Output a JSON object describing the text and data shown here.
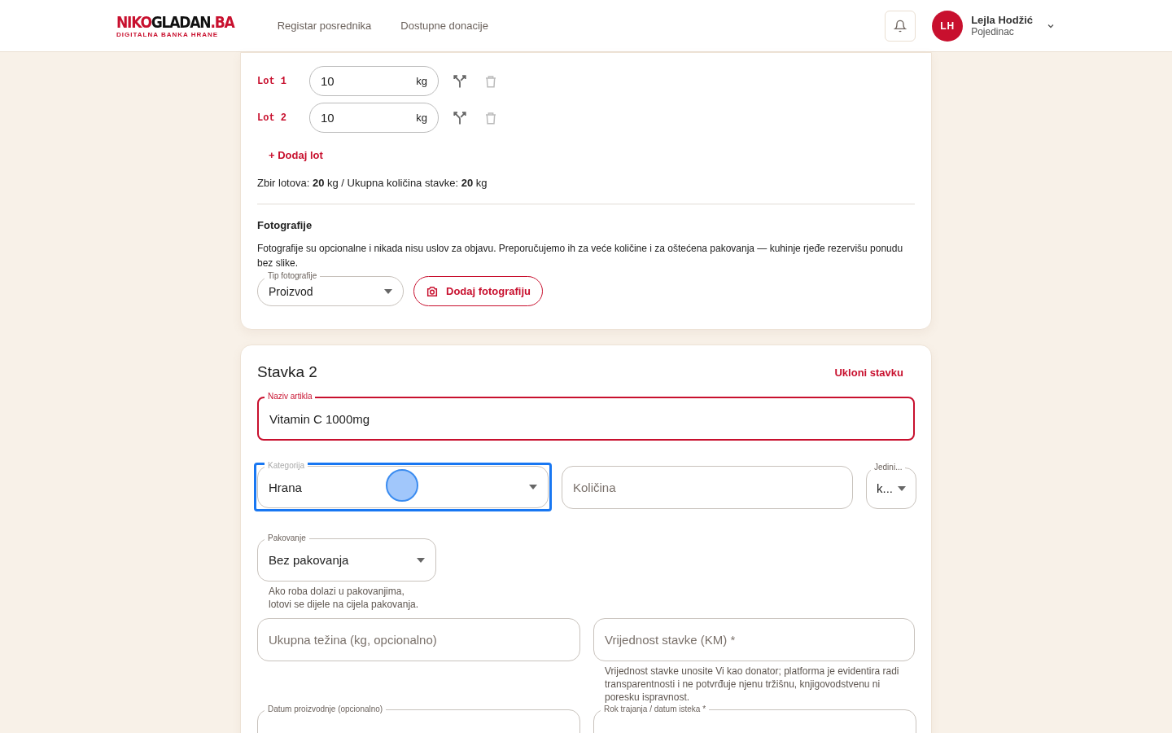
{
  "header": {
    "logo": {
      "part_1": "NIKO",
      "part_2": "GLADAN",
      "part_3": ".BA",
      "tagline": "DIGITALNA BANKA HRANE"
    },
    "nav": [
      "Registar posrednika",
      "Dostupne donacije"
    ],
    "user": {
      "initials": "LH",
      "name": "Lejla Hodžić",
      "role": "Pojedinac"
    }
  },
  "item_1": {
    "lots": [
      {
        "label": "Lot 1",
        "value": "10",
        "unit": "kg"
      },
      {
        "label": "Lot 2",
        "value": "10",
        "unit": "kg"
      }
    ],
    "add_lot": "+ Dodaj lot",
    "summary": "Zbir lotova: **20** kg / Ukupna količina stavke: **20** kg",
    "photos": {
      "title": "Fotografije",
      "text": "Fotografije su opcionalne i nikada nisu uslov za objavu. Preporučujemo ih za veće količine i za oštećena pakovanja — kuhinje rjeđe rezervišu ponudu bez slike.",
      "type_label": "Tip fotografije",
      "type_value": "Proizvod",
      "add_button": "Dodaj fotografiju"
    }
  },
  "item_2": {
    "title": "Stavka 2",
    "remove": "Ukloni stavku",
    "name": {
      "label": "Naziv artikla",
      "value": "Vitamin C 1000mg"
    },
    "category": {
      "label": "Kategorija",
      "value": "Hrana",
      "focused": true
    },
    "quantity": {
      "placeholder": "Količina"
    },
    "unit": {
      "label": "Jedini...",
      "value": "k..."
    },
    "packaging": {
      "label": "Pakovanje",
      "value": "Bez pakovanja",
      "helper": "Ako roba dolazi u pakovanjima,\nlotovi se dijele na cijela pakovanja."
    },
    "weight": {
      "placeholder": "Ukupna težina (kg, opcionalno)"
    },
    "value": {
      "placeholder": "Vrijednost stavke (KM) *",
      "helper": "Vrijednost stavke unosite Vi kao donator; platforma je evidentira radi transparentnosti i ne potvrđuje njenu tržišnu, knjigovodstvenu ni poresku ispravnost."
    },
    "production_date": {
      "label": "Datum proizvodnje (opcionalno)"
    },
    "expiry_date": {
      "label": "Rok trajanja / datum isteka *"
    }
  }
}
